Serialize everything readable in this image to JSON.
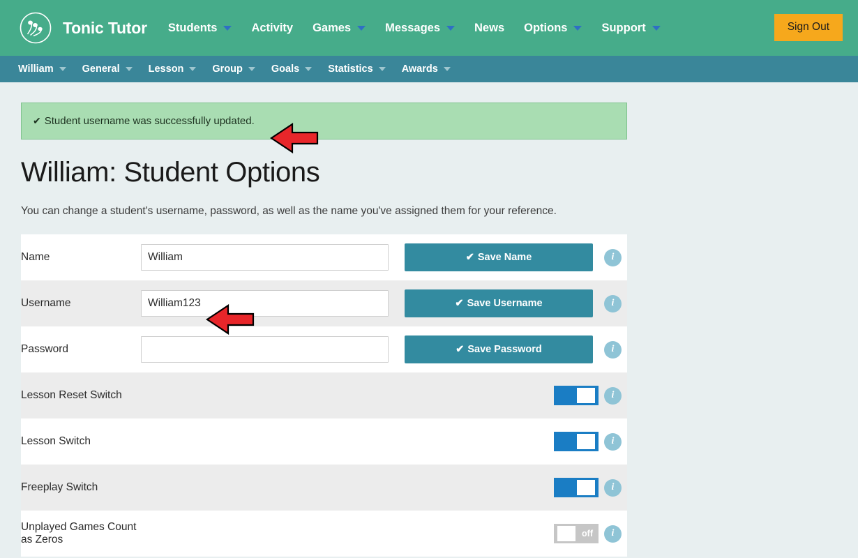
{
  "header": {
    "brand": "Tonic Tutor",
    "logo_icon": "music-notes-circle-logo",
    "nav": [
      {
        "label": "Students",
        "has_dropdown": true
      },
      {
        "label": "Activity",
        "has_dropdown": false
      },
      {
        "label": "Games",
        "has_dropdown": true
      },
      {
        "label": "Messages",
        "has_dropdown": true
      },
      {
        "label": "News",
        "has_dropdown": false
      },
      {
        "label": "Options",
        "has_dropdown": true
      },
      {
        "label": "Support",
        "has_dropdown": true
      }
    ],
    "sign_out_label": "Sign Out",
    "colors": {
      "header_bg": "#46ac8a",
      "subnav_bg": "#3a8699",
      "caret": "#2f6fc4",
      "sign_out_bg": "#f6a81c"
    }
  },
  "subnav": [
    {
      "label": "William",
      "has_dropdown": true
    },
    {
      "label": "General",
      "has_dropdown": true
    },
    {
      "label": "Lesson",
      "has_dropdown": true
    },
    {
      "label": "Group",
      "has_dropdown": true
    },
    {
      "label": "Goals",
      "has_dropdown": true
    },
    {
      "label": "Statistics",
      "has_dropdown": true
    },
    {
      "label": "Awards",
      "has_dropdown": true
    }
  ],
  "alert": {
    "icon": "check-icon",
    "message": "Student username was successfully updated.",
    "bg_color": "#a9ddb2"
  },
  "main": {
    "title": "William: Student Options",
    "description": "You can change a student's username, password, as well as the name you've assigned them for your reference."
  },
  "form_rows": [
    {
      "label": "Name",
      "type": "text",
      "value": "William",
      "placeholder": "",
      "button": "Save Name",
      "info_icon": "info-icon"
    },
    {
      "label": "Username",
      "type": "text",
      "value": "William123",
      "placeholder": "",
      "button": "Save Username",
      "info_icon": "info-icon"
    },
    {
      "label": "Password",
      "type": "text",
      "value": "",
      "placeholder": "",
      "button": "Save Password",
      "info_icon": "info-icon"
    }
  ],
  "toggle_rows": [
    {
      "label": "Lesson Reset Switch",
      "state": "on",
      "state_text": "",
      "info_icon": "info-icon"
    },
    {
      "label": "Lesson Switch",
      "state": "on",
      "state_text": "",
      "info_icon": "info-icon"
    },
    {
      "label": "Freeplay Switch",
      "state": "on",
      "state_text": "",
      "info_icon": "info-icon"
    },
    {
      "label": "Unplayed Games Count as Zeros",
      "state": "off",
      "state_text": "off",
      "info_icon": "info-icon"
    }
  ],
  "annotations": {
    "color": "#e8262a",
    "arrows": [
      {
        "name": "alert-arrow",
        "points": "left"
      },
      {
        "name": "username-arrow",
        "points": "left"
      }
    ]
  }
}
